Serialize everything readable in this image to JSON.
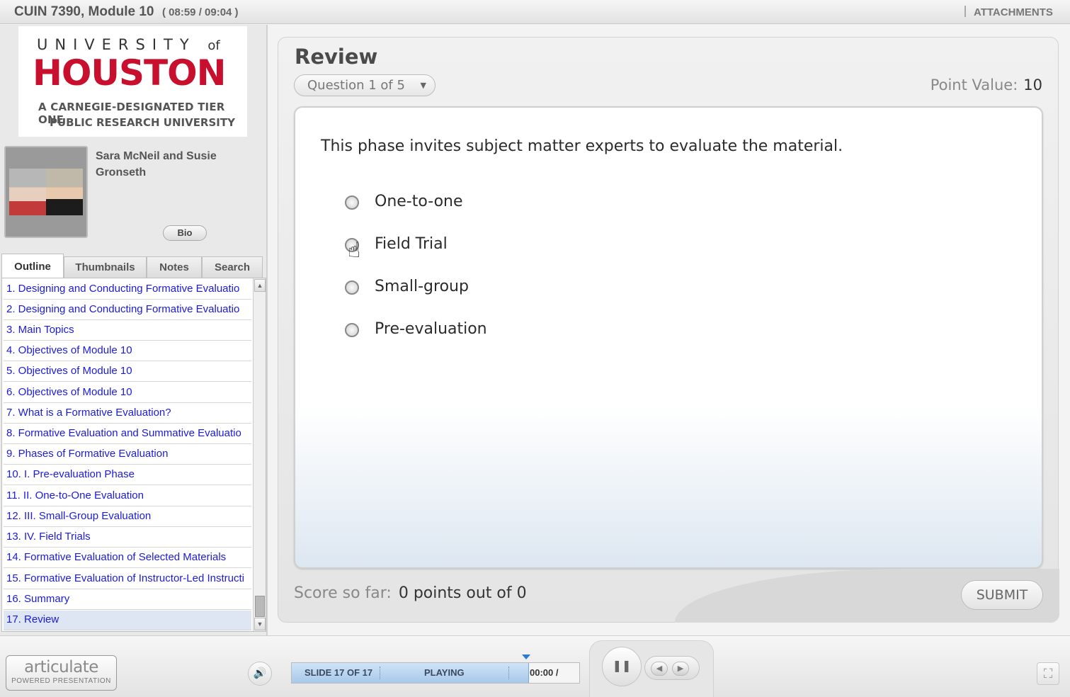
{
  "topbar": {
    "course": "CUIN 7390, Module 10",
    "time": "( 08:59 / 09:04 )",
    "attachments": "ATTACHMENTS"
  },
  "logo": {
    "line1": "UNIVERSITY",
    "line1_of": "of",
    "line2": "HOUSTON",
    "line3": "A CARNEGIE-DESIGNATED TIER ONE",
    "line4": "PUBLIC RESEARCH UNIVERSITY",
    "brand_color": "#c8102e"
  },
  "presenter": {
    "name": "Sara McNeil and Susie Gronseth",
    "bio_label": "Bio"
  },
  "tabs": [
    "Outline",
    "Thumbnails",
    "Notes",
    "Search"
  ],
  "outline": {
    "items": [
      "1. Designing and Conducting Formative Evaluatio",
      "2. Designing and Conducting Formative Evaluatio",
      "3. Main Topics",
      "4. Objectives of Module 10",
      "5. Objectives of Module 10",
      "6. Objectives of Module 10",
      "7. What is a Formative Evaluation?",
      "8. Formative Evaluation and Summative Evaluatio",
      "9. Phases of Formative Evaluation",
      "10. I. Pre-evaluation Phase",
      "11. II. One-to-One Evaluation",
      "12. III. Small-Group Evaluation",
      "13. IV. Field Trials",
      "14. Formative Evaluation of Selected Materials",
      "15. Formative Evaluation of Instructor-Led Instructi",
      "16. Summary",
      "17. Review"
    ],
    "selected_index": 16
  },
  "review": {
    "title": "Review",
    "question_select": "Question 1 of 5",
    "point_value_label": "Point Value:",
    "point_value": "10",
    "question": "This phase invites subject matter experts to evaluate the material.",
    "options": [
      "One-to-one",
      "Field Trial",
      "Small-group",
      "Pre-evaluation"
    ],
    "score_label": "Score so far:",
    "score_value": "0 points out of 0",
    "submit_label": "SUBMIT"
  },
  "player": {
    "brand_name": "articulate",
    "brand_sub": "POWERED PRESENTATION",
    "slide_status": "SLIDE 17 OF 17",
    "play_state": "PLAYING",
    "elapsed": "00:00 /",
    "progress_fraction": 0.82
  },
  "icons": {
    "volume": "speaker-icon",
    "pause": "pause-icon",
    "prev": "previous-icon",
    "next": "next-icon",
    "fullscreen": "fullscreen-icon",
    "cursor": "hand-pointer-icon"
  }
}
